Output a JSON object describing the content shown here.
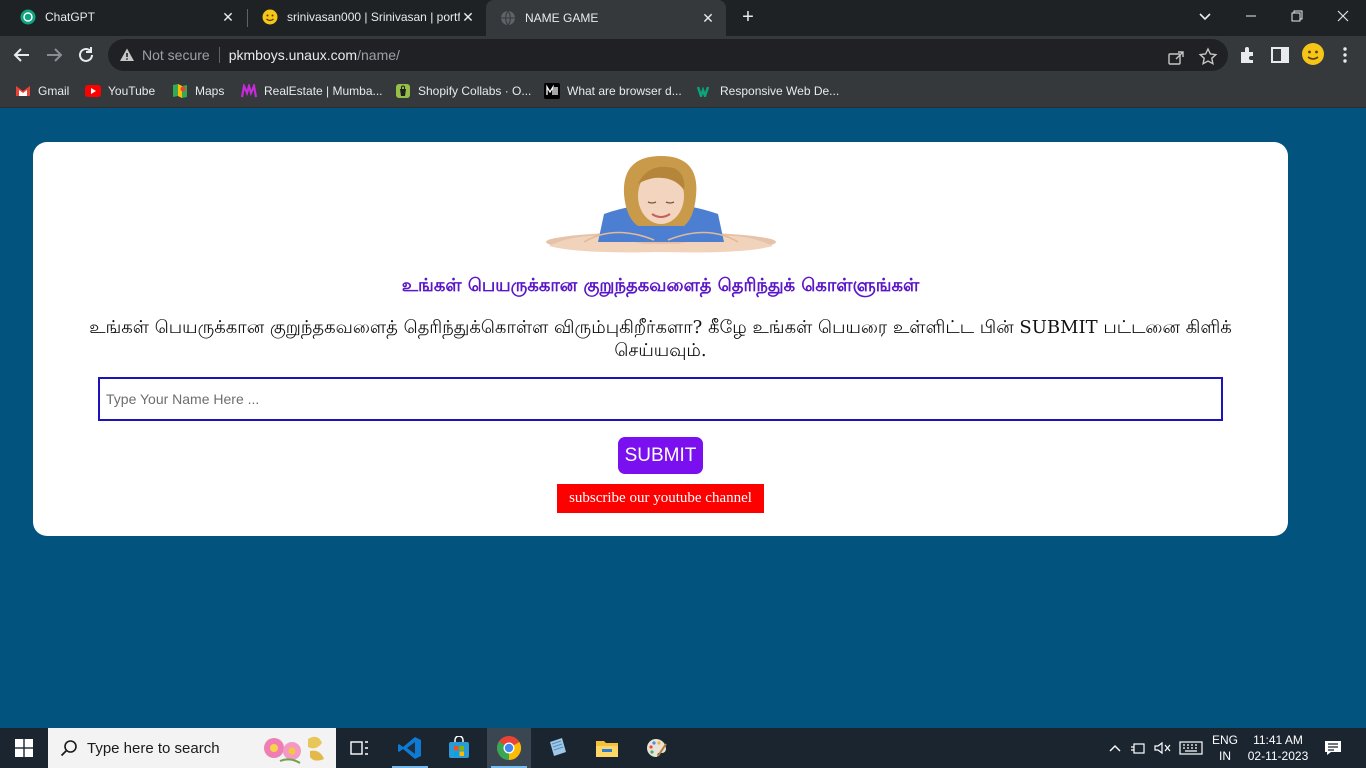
{
  "browser": {
    "tabs": [
      {
        "title": "ChatGPT",
        "favicon": "chatgpt-icon",
        "active": false
      },
      {
        "title": "srinivasan000 | Srinivasan | portf",
        "favicon": "emoji-face-icon",
        "active": false
      },
      {
        "title": "NAME GAME",
        "favicon": "globe-icon",
        "active": true
      }
    ],
    "address": {
      "security_label": "Not secure",
      "host": "pkmboys.unaux.com",
      "path": "/name/"
    },
    "bookmarks": [
      {
        "label": "Gmail",
        "icon": "gmail-icon"
      },
      {
        "label": "YouTube",
        "icon": "youtube-icon"
      },
      {
        "label": "Maps",
        "icon": "maps-icon"
      },
      {
        "label": "RealEstate | Mumba...",
        "icon": "realestate-icon"
      },
      {
        "label": "Shopify Collabs · O...",
        "icon": "shopify-icon"
      },
      {
        "label": "What are browser d...",
        "icon": "medium-icon"
      },
      {
        "label": "Responsive Web De...",
        "icon": "webflow-icon"
      }
    ]
  },
  "page": {
    "heading": "உங்கள் பெயருக்கான குறுந்தகவளைத் தெரிந்துக் கொள்ளுங்கள்",
    "description": "உங்கள் பெயருக்கான குறுந்தகவளைத் தெரிந்துக்கொள்ள விரும்புகிறீர்களா? கீழே உங்கள் பெயரை உள்ளிட்ட பின் SUBMIT பட்டனை கிளிக் செய்யவும்.",
    "name_input": {
      "value": "",
      "placeholder": "Type Your Name Here ..."
    },
    "submit_label": "SUBMIT",
    "subscribe_label": "subscribe our youtube channel",
    "colors": {
      "background": "#03537f",
      "heading": "#5b16c7",
      "input_border": "#1e13b8",
      "submit": "#7a10ef",
      "subscribe": "#ff0000"
    }
  },
  "taskbar": {
    "search_placeholder": "Type here to search",
    "language": {
      "line1": "ENG",
      "line2": "IN"
    },
    "time": "11:41 AM",
    "date": "02-11-2023"
  }
}
